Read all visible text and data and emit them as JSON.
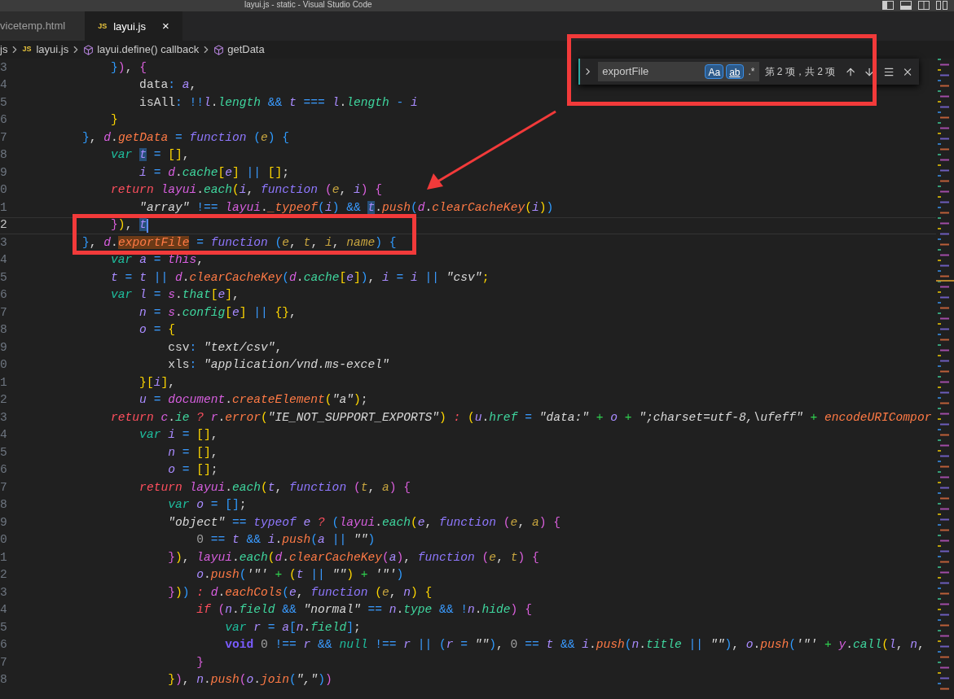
{
  "window": {
    "title": "layui.js - static - Visual Studio Code"
  },
  "tabs": [
    {
      "label": "vicetemp.html",
      "selected": false
    },
    {
      "badge": "JS",
      "label": "layui.js",
      "close": "×",
      "selected": true
    }
  ],
  "breadcrumbs": [
    {
      "kind": "folder",
      "label": "js"
    },
    {
      "kind": "file",
      "badge": "JS",
      "label": "layui.js"
    },
    {
      "kind": "symbol",
      "label": "layui.define() callback"
    },
    {
      "kind": "symbol",
      "label": "getData"
    }
  ],
  "find": {
    "value": "exportFile",
    "options": [
      {
        "label": "Aa",
        "selected": true
      },
      {
        "label": "ab",
        "selected": true
      },
      {
        "label": ".*",
        "selected": false
      }
    ],
    "result": "第 2 项，共 2 项"
  },
  "lines": [
    {
      "number": "3",
      "current": false,
      "tokens": [
        {
          "kind": "brace3",
          "text": "            }"
        },
        {
          "kind": "brace2",
          "text": ")"
        },
        {
          "kind": "plain",
          "text": ", "
        },
        {
          "kind": "brace2",
          "text": "{"
        }
      ]
    },
    {
      "number": "4",
      "current": false,
      "tokens": [
        {
          "kind": "plain",
          "text": "                data"
        },
        {
          "kind": "op",
          "text": ": "
        },
        {
          "kind": "var",
          "text": "a"
        },
        {
          "kind": "plain",
          "text": ","
        }
      ]
    },
    {
      "number": "5",
      "current": false,
      "tokens": [
        {
          "kind": "plain",
          "text": "                isAll"
        },
        {
          "kind": "op",
          "text": ": !!"
        },
        {
          "kind": "var",
          "text": "l"
        },
        {
          "kind": "plain",
          "text": "."
        },
        {
          "kind": "prop",
          "text": "length"
        },
        {
          "kind": "op",
          "text": " && "
        },
        {
          "kind": "var",
          "text": "t"
        },
        {
          "kind": "op",
          "text": " === "
        },
        {
          "kind": "var",
          "text": "l"
        },
        {
          "kind": "plain",
          "text": "."
        },
        {
          "kind": "prop",
          "text": "length"
        },
        {
          "kind": "op",
          "text": " - "
        },
        {
          "kind": "var",
          "text": "i"
        }
      ]
    },
    {
      "number": "6",
      "current": false,
      "tokens": [
        {
          "kind": "brace1",
          "text": "            }"
        }
      ]
    },
    {
      "number": "7",
      "current": false,
      "tokens": [
        {
          "kind": "brace3",
          "text": "        }"
        },
        {
          "kind": "plain",
          "text": ", "
        },
        {
          "kind": "obj",
          "text": "d"
        },
        {
          "kind": "plain",
          "text": "."
        },
        {
          "kind": "method",
          "text": "getData"
        },
        {
          "kind": "op",
          "text": " = "
        },
        {
          "kind": "func",
          "text": "function "
        },
        {
          "kind": "brace3",
          "text": "("
        },
        {
          "kind": "param",
          "text": "e"
        },
        {
          "kind": "brace3",
          "text": ")"
        },
        {
          "kind": "brace3",
          "text": " {"
        }
      ]
    },
    {
      "number": "8",
      "current": false,
      "tokens": [
        {
          "kind": "keyword",
          "text": "            var "
        },
        {
          "kind": "occur",
          "text": "t"
        },
        {
          "kind": "op",
          "text": " = "
        },
        {
          "kind": "brace1",
          "text": "[]"
        },
        {
          "kind": "plain",
          "text": ","
        }
      ]
    },
    {
      "number": "9",
      "current": false,
      "tokens": [
        {
          "kind": "var",
          "text": "                i"
        },
        {
          "kind": "op",
          "text": " = "
        },
        {
          "kind": "obj",
          "text": "d"
        },
        {
          "kind": "plain",
          "text": "."
        },
        {
          "kind": "prop",
          "text": "cache"
        },
        {
          "kind": "brace1",
          "text": "["
        },
        {
          "kind": "var",
          "text": "e"
        },
        {
          "kind": "brace1",
          "text": "]"
        },
        {
          "kind": "op",
          "text": " || "
        },
        {
          "kind": "brace1",
          "text": "[]"
        },
        {
          "kind": "plain",
          "text": ";"
        }
      ]
    },
    {
      "number": "0",
      "current": false,
      "tokens": [
        {
          "kind": "ret",
          "text": "            return "
        },
        {
          "kind": "obj",
          "text": "layui"
        },
        {
          "kind": "plain",
          "text": "."
        },
        {
          "kind": "prop",
          "text": "each"
        },
        {
          "kind": "brace1",
          "text": "("
        },
        {
          "kind": "var",
          "text": "i"
        },
        {
          "kind": "plain",
          "text": ", "
        },
        {
          "kind": "func",
          "text": "function "
        },
        {
          "kind": "brace2",
          "text": "("
        },
        {
          "kind": "param",
          "text": "e"
        },
        {
          "kind": "plain",
          "text": ", "
        },
        {
          "kind": "var",
          "text": "i"
        },
        {
          "kind": "brace2",
          "text": ")"
        },
        {
          "kind": "brace2",
          "text": " {"
        }
      ]
    },
    {
      "number": "1",
      "current": false,
      "tokens": [
        {
          "kind": "str",
          "text": "                \"array\""
        },
        {
          "kind": "op",
          "text": " !== "
        },
        {
          "kind": "obj",
          "text": "layui"
        },
        {
          "kind": "plain",
          "text": "."
        },
        {
          "kind": "method",
          "text": "_typeof"
        },
        {
          "kind": "brace3",
          "text": "("
        },
        {
          "kind": "var",
          "text": "i"
        },
        {
          "kind": "brace3",
          "text": ")"
        },
        {
          "kind": "op",
          "text": " && "
        },
        {
          "kind": "occur",
          "text": "t"
        },
        {
          "kind": "plain",
          "text": "."
        },
        {
          "kind": "method",
          "text": "push"
        },
        {
          "kind": "brace3",
          "text": "("
        },
        {
          "kind": "obj",
          "text": "d"
        },
        {
          "kind": "plain",
          "text": "."
        },
        {
          "kind": "method",
          "text": "clearCacheKey"
        },
        {
          "kind": "brace1",
          "text": "("
        },
        {
          "kind": "var",
          "text": "i"
        },
        {
          "kind": "brace1",
          "text": ")"
        },
        {
          "kind": "brace3",
          "text": ")"
        }
      ]
    },
    {
      "number": "2",
      "current": true,
      "tokens": [
        {
          "kind": "brace2",
          "text": "            }"
        },
        {
          "kind": "brace1",
          "text": ")"
        },
        {
          "kind": "plain",
          "text": ", "
        },
        {
          "kind": "occur",
          "text": "t"
        }
      ]
    },
    {
      "number": "3",
      "current": false,
      "tokens": [
        {
          "kind": "brace3",
          "text": "        }"
        },
        {
          "kind": "plain",
          "text": ", "
        },
        {
          "kind": "obj",
          "text": "d"
        },
        {
          "kind": "plain",
          "text": "."
        },
        {
          "kind": "match",
          "text": "exportFile"
        },
        {
          "kind": "op",
          "text": " = "
        },
        {
          "kind": "func",
          "text": "function "
        },
        {
          "kind": "brace3",
          "text": "("
        },
        {
          "kind": "param",
          "text": "e"
        },
        {
          "kind": "plain",
          "text": ", "
        },
        {
          "kind": "param",
          "text": "t"
        },
        {
          "kind": "plain",
          "text": ", "
        },
        {
          "kind": "param",
          "text": "i"
        },
        {
          "kind": "plain",
          "text": ", "
        },
        {
          "kind": "param",
          "text": "name"
        },
        {
          "kind": "brace3",
          "text": ")"
        },
        {
          "kind": "brace3",
          "text": " {"
        }
      ]
    },
    {
      "number": "4",
      "current": false,
      "tokens": [
        {
          "kind": "keyword",
          "text": "            var "
        },
        {
          "kind": "var",
          "text": "a"
        },
        {
          "kind": "op",
          "text": " = "
        },
        {
          "kind": "obj",
          "text": "this"
        },
        {
          "kind": "plain",
          "text": ","
        }
      ]
    },
    {
      "number": "5",
      "current": false,
      "tokens": [
        {
          "kind": "var",
          "text": "            t"
        },
        {
          "kind": "op",
          "text": " = "
        },
        {
          "kind": "var",
          "text": "t"
        },
        {
          "kind": "op",
          "text": " || "
        },
        {
          "kind": "obj",
          "text": "d"
        },
        {
          "kind": "plain",
          "text": "."
        },
        {
          "kind": "method",
          "text": "clearCacheKey"
        },
        {
          "kind": "brace3",
          "text": "("
        },
        {
          "kind": "obj",
          "text": "d"
        },
        {
          "kind": "plain",
          "text": "."
        },
        {
          "kind": "prop",
          "text": "cache"
        },
        {
          "kind": "brace1",
          "text": "["
        },
        {
          "kind": "var",
          "text": "e"
        },
        {
          "kind": "brace1",
          "text": "]"
        },
        {
          "kind": "brace3",
          "text": ")"
        },
        {
          "kind": "plain",
          "text": ", "
        },
        {
          "kind": "var",
          "text": "i"
        },
        {
          "kind": "op",
          "text": " = "
        },
        {
          "kind": "var",
          "text": "i"
        },
        {
          "kind": "op",
          "text": " || "
        },
        {
          "kind": "str",
          "text": "\"csv\""
        },
        {
          "kind": "brace1",
          "text": ";"
        }
      ]
    },
    {
      "number": "6",
      "current": false,
      "tokens": [
        {
          "kind": "keyword",
          "text": "            var "
        },
        {
          "kind": "var",
          "text": "l"
        },
        {
          "kind": "op",
          "text": " = "
        },
        {
          "kind": "obj",
          "text": "s"
        },
        {
          "kind": "plain",
          "text": "."
        },
        {
          "kind": "prop",
          "text": "that"
        },
        {
          "kind": "brace1",
          "text": "["
        },
        {
          "kind": "var",
          "text": "e"
        },
        {
          "kind": "brace1",
          "text": "]"
        },
        {
          "kind": "plain",
          "text": ","
        }
      ]
    },
    {
      "number": "7",
      "current": false,
      "tokens": [
        {
          "kind": "var",
          "text": "                n"
        },
        {
          "kind": "op",
          "text": " = "
        },
        {
          "kind": "obj",
          "text": "s"
        },
        {
          "kind": "plain",
          "text": "."
        },
        {
          "kind": "prop",
          "text": "config"
        },
        {
          "kind": "brace1",
          "text": "["
        },
        {
          "kind": "var",
          "text": "e"
        },
        {
          "kind": "brace1",
          "text": "]"
        },
        {
          "kind": "op",
          "text": " || "
        },
        {
          "kind": "brace1",
          "text": "{}"
        },
        {
          "kind": "plain",
          "text": ","
        }
      ]
    },
    {
      "number": "8",
      "current": false,
      "tokens": [
        {
          "kind": "var",
          "text": "                o"
        },
        {
          "kind": "op",
          "text": " = "
        },
        {
          "kind": "brace1",
          "text": "{"
        }
      ]
    },
    {
      "number": "9",
      "current": false,
      "tokens": [
        {
          "kind": "plain",
          "text": "                    csv"
        },
        {
          "kind": "op",
          "text": ": "
        },
        {
          "kind": "str",
          "text": "\"text/csv\""
        },
        {
          "kind": "plain",
          "text": ","
        }
      ]
    },
    {
      "number": "0",
      "current": false,
      "tokens": [
        {
          "kind": "plain",
          "text": "                    xls"
        },
        {
          "kind": "op",
          "text": ": "
        },
        {
          "kind": "str",
          "text": "\"application/vnd.ms-excel\""
        }
      ]
    },
    {
      "number": "1",
      "current": false,
      "tokens": [
        {
          "kind": "brace1",
          "text": "                }["
        },
        {
          "kind": "var",
          "text": "i"
        },
        {
          "kind": "brace1",
          "text": "]"
        },
        {
          "kind": "plain",
          "text": ","
        }
      ]
    },
    {
      "number": "2",
      "current": false,
      "tokens": [
        {
          "kind": "var",
          "text": "                u"
        },
        {
          "kind": "op",
          "text": " = "
        },
        {
          "kind": "obj",
          "text": "document"
        },
        {
          "kind": "plain",
          "text": "."
        },
        {
          "kind": "method",
          "text": "createElement"
        },
        {
          "kind": "brace1",
          "text": "("
        },
        {
          "kind": "str",
          "text": "\"a\""
        },
        {
          "kind": "brace1",
          "text": ")"
        },
        {
          "kind": "plain",
          "text": ";"
        }
      ]
    },
    {
      "number": "3",
      "current": false,
      "tokens": [
        {
          "kind": "ret",
          "text": "            return "
        },
        {
          "kind": "obj",
          "text": "c"
        },
        {
          "kind": "plain",
          "text": "."
        },
        {
          "kind": "prop",
          "text": "ie"
        },
        {
          "kind": "ret",
          "text": " ? "
        },
        {
          "kind": "obj",
          "text": "r"
        },
        {
          "kind": "plain",
          "text": "."
        },
        {
          "kind": "method",
          "text": "error"
        },
        {
          "kind": "brace1",
          "text": "("
        },
        {
          "kind": "str",
          "text": "\"IE_NOT_SUPPORT_EXPORTS\""
        },
        {
          "kind": "brace1",
          "text": ")"
        },
        {
          "kind": "ret",
          "text": " : "
        },
        {
          "kind": "brace1",
          "text": "("
        },
        {
          "kind": "var",
          "text": "u"
        },
        {
          "kind": "plain",
          "text": "."
        },
        {
          "kind": "prop",
          "text": "href"
        },
        {
          "kind": "op",
          "text": " = "
        },
        {
          "kind": "str",
          "text": "\"data:\""
        },
        {
          "kind": "plus",
          "text": " + "
        },
        {
          "kind": "var",
          "text": "o"
        },
        {
          "kind": "plus",
          "text": " + "
        },
        {
          "kind": "str",
          "text": "\";charset=utf-8,\\ufeff\""
        },
        {
          "kind": "plus",
          "text": " + "
        },
        {
          "kind": "method",
          "text": "encodeURICompor"
        }
      ]
    },
    {
      "number": "4",
      "current": false,
      "tokens": [
        {
          "kind": "keyword",
          "text": "                var "
        },
        {
          "kind": "var",
          "text": "i"
        },
        {
          "kind": "op",
          "text": " = "
        },
        {
          "kind": "brace1",
          "text": "[]"
        },
        {
          "kind": "plain",
          "text": ","
        }
      ]
    },
    {
      "number": "5",
      "current": false,
      "tokens": [
        {
          "kind": "var",
          "text": "                    n"
        },
        {
          "kind": "op",
          "text": " = "
        },
        {
          "kind": "brace1",
          "text": "[]"
        },
        {
          "kind": "plain",
          "text": ","
        }
      ]
    },
    {
      "number": "6",
      "current": false,
      "tokens": [
        {
          "kind": "var",
          "text": "                    o"
        },
        {
          "kind": "op",
          "text": " = "
        },
        {
          "kind": "brace1",
          "text": "[]"
        },
        {
          "kind": "plain",
          "text": ";"
        }
      ]
    },
    {
      "number": "7",
      "current": false,
      "tokens": [
        {
          "kind": "ret",
          "text": "                return "
        },
        {
          "kind": "obj",
          "text": "layui"
        },
        {
          "kind": "plain",
          "text": "."
        },
        {
          "kind": "prop",
          "text": "each"
        },
        {
          "kind": "brace1",
          "text": "("
        },
        {
          "kind": "var",
          "text": "t"
        },
        {
          "kind": "plain",
          "text": ", "
        },
        {
          "kind": "func",
          "text": "function "
        },
        {
          "kind": "brace2",
          "text": "("
        },
        {
          "kind": "param",
          "text": "t"
        },
        {
          "kind": "plain",
          "text": ", "
        },
        {
          "kind": "param",
          "text": "a"
        },
        {
          "kind": "brace2",
          "text": ")"
        },
        {
          "kind": "brace2",
          "text": " {"
        }
      ]
    },
    {
      "number": "8",
      "current": false,
      "tokens": [
        {
          "kind": "keyword",
          "text": "                    var "
        },
        {
          "kind": "var",
          "text": "o"
        },
        {
          "kind": "op",
          "text": " = "
        },
        {
          "kind": "brace3",
          "text": "[]"
        },
        {
          "kind": "plain",
          "text": ";"
        }
      ]
    },
    {
      "number": "9",
      "current": false,
      "tokens": [
        {
          "kind": "str",
          "text": "                    \"object\""
        },
        {
          "kind": "op",
          "text": " == "
        },
        {
          "kind": "func",
          "text": "typeof "
        },
        {
          "kind": "var",
          "text": "e"
        },
        {
          "kind": "ret",
          "text": " ? "
        },
        {
          "kind": "brace3",
          "text": "("
        },
        {
          "kind": "obj",
          "text": "layui"
        },
        {
          "kind": "plain",
          "text": "."
        },
        {
          "kind": "prop",
          "text": "each"
        },
        {
          "kind": "brace1",
          "text": "("
        },
        {
          "kind": "var",
          "text": "e"
        },
        {
          "kind": "plain",
          "text": ", "
        },
        {
          "kind": "func",
          "text": "function "
        },
        {
          "kind": "brace2",
          "text": "("
        },
        {
          "kind": "param",
          "text": "e"
        },
        {
          "kind": "plain",
          "text": ", "
        },
        {
          "kind": "param",
          "text": "a"
        },
        {
          "kind": "brace2",
          "text": ")"
        },
        {
          "kind": "brace2",
          "text": " {"
        }
      ]
    },
    {
      "number": "0",
      "current": false,
      "tokens": [
        {
          "kind": "num",
          "text": "                        0"
        },
        {
          "kind": "op",
          "text": " == "
        },
        {
          "kind": "var",
          "text": "t"
        },
        {
          "kind": "op",
          "text": " && "
        },
        {
          "kind": "var",
          "text": "i"
        },
        {
          "kind": "plain",
          "text": "."
        },
        {
          "kind": "method",
          "text": "push"
        },
        {
          "kind": "brace3",
          "text": "("
        },
        {
          "kind": "var",
          "text": "a"
        },
        {
          "kind": "op",
          "text": " || "
        },
        {
          "kind": "str",
          "text": "\"\""
        },
        {
          "kind": "brace3",
          "text": ")"
        }
      ]
    },
    {
      "number": "1",
      "current": false,
      "tokens": [
        {
          "kind": "brace2",
          "text": "                    }"
        },
        {
          "kind": "brace1",
          "text": ")"
        },
        {
          "kind": "plain",
          "text": ", "
        },
        {
          "kind": "obj",
          "text": "layui"
        },
        {
          "kind": "plain",
          "text": "."
        },
        {
          "kind": "prop",
          "text": "each"
        },
        {
          "kind": "brace1",
          "text": "("
        },
        {
          "kind": "obj",
          "text": "d"
        },
        {
          "kind": "plain",
          "text": "."
        },
        {
          "kind": "method",
          "text": "clearCacheKey"
        },
        {
          "kind": "brace2",
          "text": "("
        },
        {
          "kind": "var",
          "text": "a"
        },
        {
          "kind": "brace2",
          "text": ")"
        },
        {
          "kind": "plain",
          "text": ", "
        },
        {
          "kind": "func",
          "text": "function "
        },
        {
          "kind": "brace2",
          "text": "("
        },
        {
          "kind": "param",
          "text": "e"
        },
        {
          "kind": "plain",
          "text": ", "
        },
        {
          "kind": "param",
          "text": "t"
        },
        {
          "kind": "brace2",
          "text": ")"
        },
        {
          "kind": "brace2",
          "text": " {"
        }
      ]
    },
    {
      "number": "2",
      "current": false,
      "tokens": [
        {
          "kind": "var",
          "text": "                        o"
        },
        {
          "kind": "plain",
          "text": "."
        },
        {
          "kind": "method",
          "text": "push"
        },
        {
          "kind": "brace3",
          "text": "("
        },
        {
          "kind": "str",
          "text": "'\"'"
        },
        {
          "kind": "plus",
          "text": " + "
        },
        {
          "kind": "brace1",
          "text": "("
        },
        {
          "kind": "var",
          "text": "t"
        },
        {
          "kind": "op",
          "text": " || "
        },
        {
          "kind": "str",
          "text": "\"\""
        },
        {
          "kind": "brace1",
          "text": ")"
        },
        {
          "kind": "plus",
          "text": " + "
        },
        {
          "kind": "str",
          "text": "'\"'"
        },
        {
          "kind": "brace3",
          "text": ")"
        }
      ]
    },
    {
      "number": "3",
      "current": false,
      "tokens": [
        {
          "kind": "brace2",
          "text": "                    }"
        },
        {
          "kind": "brace1",
          "text": ")"
        },
        {
          "kind": "brace3",
          "text": ")"
        },
        {
          "kind": "ret",
          "text": " : "
        },
        {
          "kind": "obj",
          "text": "d"
        },
        {
          "kind": "plain",
          "text": "."
        },
        {
          "kind": "method",
          "text": "eachCols"
        },
        {
          "kind": "brace3",
          "text": "("
        },
        {
          "kind": "var",
          "text": "e"
        },
        {
          "kind": "plain",
          "text": ", "
        },
        {
          "kind": "func",
          "text": "function "
        },
        {
          "kind": "brace1",
          "text": "("
        },
        {
          "kind": "param",
          "text": "e"
        },
        {
          "kind": "plain",
          "text": ", "
        },
        {
          "kind": "var",
          "text": "n"
        },
        {
          "kind": "brace1",
          "text": ")"
        },
        {
          "kind": "brace1",
          "text": " {"
        }
      ]
    },
    {
      "number": "4",
      "current": false,
      "tokens": [
        {
          "kind": "ret",
          "text": "                        if "
        },
        {
          "kind": "brace2",
          "text": "("
        },
        {
          "kind": "var",
          "text": "n"
        },
        {
          "kind": "plain",
          "text": "."
        },
        {
          "kind": "prop",
          "text": "field"
        },
        {
          "kind": "op",
          "text": " && "
        },
        {
          "kind": "str",
          "text": "\"normal\""
        },
        {
          "kind": "op",
          "text": " == "
        },
        {
          "kind": "var",
          "text": "n"
        },
        {
          "kind": "plain",
          "text": "."
        },
        {
          "kind": "prop",
          "text": "type"
        },
        {
          "kind": "op",
          "text": " && !"
        },
        {
          "kind": "var",
          "text": "n"
        },
        {
          "kind": "plain",
          "text": "."
        },
        {
          "kind": "prop",
          "text": "hide"
        },
        {
          "kind": "brace2",
          "text": ")"
        },
        {
          "kind": "brace2",
          "text": " {"
        }
      ]
    },
    {
      "number": "5",
      "current": false,
      "tokens": [
        {
          "kind": "keyword",
          "text": "                            var "
        },
        {
          "kind": "var",
          "text": "r"
        },
        {
          "kind": "op",
          "text": " = "
        },
        {
          "kind": "var",
          "text": "a"
        },
        {
          "kind": "brace3",
          "text": "["
        },
        {
          "kind": "var",
          "text": "n"
        },
        {
          "kind": "plain",
          "text": "."
        },
        {
          "kind": "prop",
          "text": "field"
        },
        {
          "kind": "brace3",
          "text": "]"
        },
        {
          "kind": "plain",
          "text": ";"
        }
      ]
    },
    {
      "number": "6",
      "current": false,
      "tokens": [
        {
          "kind": "void",
          "text": "                            void "
        },
        {
          "kind": "num",
          "text": "0"
        },
        {
          "kind": "op",
          "text": " !== "
        },
        {
          "kind": "var",
          "text": "r"
        },
        {
          "kind": "op",
          "text": " && "
        },
        {
          "kind": "keyword",
          "text": "null"
        },
        {
          "kind": "op",
          "text": " !== "
        },
        {
          "kind": "var",
          "text": "r"
        },
        {
          "kind": "op",
          "text": " || "
        },
        {
          "kind": "brace3",
          "text": "("
        },
        {
          "kind": "var",
          "text": "r"
        },
        {
          "kind": "op",
          "text": " = "
        },
        {
          "kind": "str",
          "text": "\"\""
        },
        {
          "kind": "brace3",
          "text": ")"
        },
        {
          "kind": "plain",
          "text": ", "
        },
        {
          "kind": "num",
          "text": "0"
        },
        {
          "kind": "op",
          "text": " == "
        },
        {
          "kind": "var",
          "text": "t"
        },
        {
          "kind": "op",
          "text": " && "
        },
        {
          "kind": "var",
          "text": "i"
        },
        {
          "kind": "plain",
          "text": "."
        },
        {
          "kind": "method",
          "text": "push"
        },
        {
          "kind": "brace3",
          "text": "("
        },
        {
          "kind": "var",
          "text": "n"
        },
        {
          "kind": "plain",
          "text": "."
        },
        {
          "kind": "prop",
          "text": "title"
        },
        {
          "kind": "op",
          "text": " || "
        },
        {
          "kind": "str",
          "text": "\"\""
        },
        {
          "kind": "brace3",
          "text": ")"
        },
        {
          "kind": "plain",
          "text": ", "
        },
        {
          "kind": "var",
          "text": "o"
        },
        {
          "kind": "plain",
          "text": "."
        },
        {
          "kind": "method",
          "text": "push"
        },
        {
          "kind": "brace3",
          "text": "("
        },
        {
          "kind": "str",
          "text": "'\"'"
        },
        {
          "kind": "plus",
          "text": " + "
        },
        {
          "kind": "obj",
          "text": "y"
        },
        {
          "kind": "plain",
          "text": "."
        },
        {
          "kind": "prop",
          "text": "call"
        },
        {
          "kind": "brace1",
          "text": "("
        },
        {
          "kind": "var",
          "text": "l"
        },
        {
          "kind": "plain",
          "text": ", "
        },
        {
          "kind": "var",
          "text": "n"
        },
        {
          "kind": "plain",
          "text": ","
        }
      ]
    },
    {
      "number": "7",
      "current": false,
      "tokens": [
        {
          "kind": "brace2",
          "text": "                        }"
        }
      ]
    },
    {
      "number": "8",
      "current": false,
      "tokens": [
        {
          "kind": "brace1",
          "text": "                    }"
        },
        {
          "kind": "brace2",
          "text": ")"
        },
        {
          "kind": "plain",
          "text": ", "
        },
        {
          "kind": "var",
          "text": "n"
        },
        {
          "kind": "plain",
          "text": "."
        },
        {
          "kind": "method",
          "text": "push"
        },
        {
          "kind": "brace2",
          "text": "("
        },
        {
          "kind": "var",
          "text": "o"
        },
        {
          "kind": "plain",
          "text": "."
        },
        {
          "kind": "method",
          "text": "join"
        },
        {
          "kind": "brace3",
          "text": "("
        },
        {
          "kind": "str",
          "text": "\",\""
        },
        {
          "kind": "brace3",
          "text": ")"
        },
        {
          "kind": "brace2",
          "text": ")"
        }
      ]
    }
  ]
}
